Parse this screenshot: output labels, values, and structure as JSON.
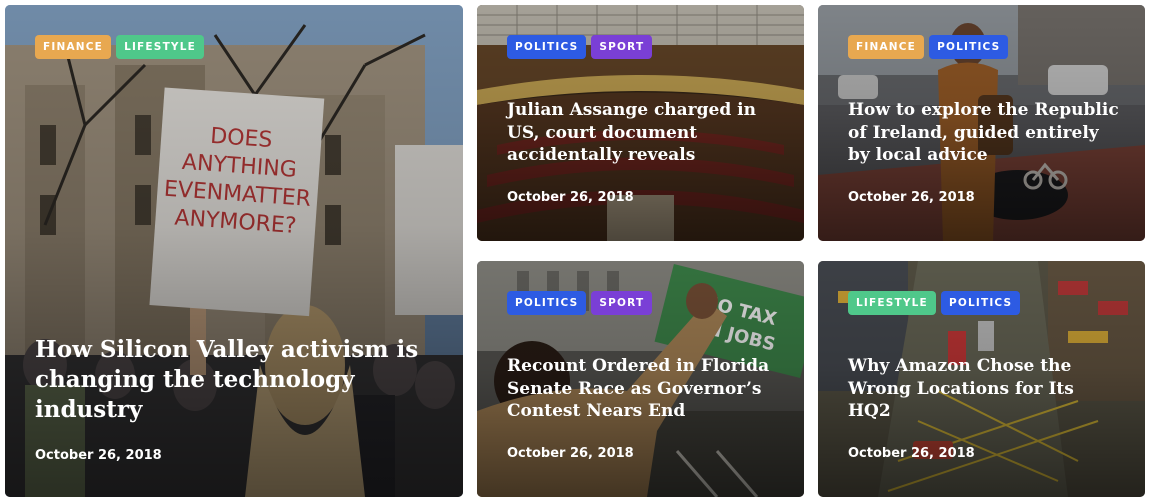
{
  "tag_colors": {
    "FINANCE": "#e8a850",
    "LIFESTYLE": "#4fc88a",
    "POLITICS": "#2d5be3",
    "SPORT": "#7a3fd6"
  },
  "cards": [
    {
      "tags": [
        "FINANCE",
        "LIFESTYLE"
      ],
      "title": "How Silicon Valley activism is changing the technology industry",
      "date": "October 26, 2018",
      "image": "protest-crowd-photo",
      "sign_text": "DOES ANYTHING EVEN MATTER ANYMORE?"
    },
    {
      "tags": [
        "POLITICS",
        "SPORT"
      ],
      "title": "Julian Assange charged in US, court document accidentally reveals",
      "date": "October 26, 2018",
      "image": "parliament-chamber-photo"
    },
    {
      "tags": [
        "FINANCE",
        "POLITICS"
      ],
      "title": "How to explore the Republic of Ireland, guided entirely by local advice",
      "date": "October 26, 2018",
      "image": "woman-street-photo"
    },
    {
      "tags": [
        "POLITICS",
        "SPORT"
      ],
      "title": "Recount Ordered in Florida Senate Race as Governor’s Contest Nears End",
      "date": "October 26, 2018",
      "image": "protester-fist-photo",
      "sign_text": "NO TAX ON JOBS"
    },
    {
      "tags": [
        "LIFESTYLE",
        "POLITICS"
      ],
      "title": "Why Amazon Chose the Wrong Locations for Its HQ2",
      "date": "October 26, 2018",
      "image": "city-street-aerial-photo"
    }
  ]
}
